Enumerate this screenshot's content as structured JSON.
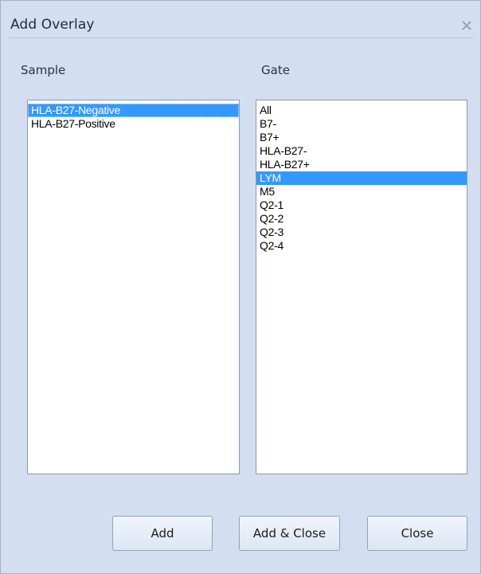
{
  "window": {
    "title": "Add Overlay",
    "close_icon": "close-x-icon"
  },
  "sample": {
    "label": "Sample",
    "items": [
      "HLA-B27-Negative",
      "HLA-B27-Positive"
    ],
    "selected_index": 0
  },
  "gate": {
    "label": "Gate",
    "items": [
      "All",
      "B7-",
      "B7+",
      "HLA-B27-",
      "HLA-B27+",
      "LYM",
      "M5",
      "Q2-1",
      "Q2-2",
      "Q2-3",
      "Q2-4"
    ],
    "selected_index": 5
  },
  "buttons": {
    "add": "Add",
    "add_close": "Add & Close",
    "close": "Close"
  },
  "colors": {
    "dialog_background": "#d3def0",
    "selection": "#3399ff"
  }
}
